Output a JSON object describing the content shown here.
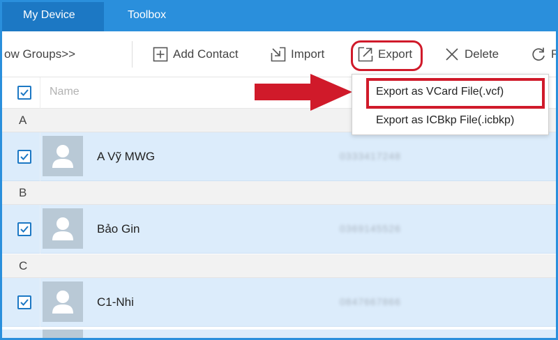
{
  "tabs": [
    {
      "label": "My Device",
      "active": true
    },
    {
      "label": "Toolbox",
      "active": false
    }
  ],
  "toolbar": {
    "groups_label": "ow Groups>>",
    "add_contact_label": "Add Contact",
    "import_label": "Import",
    "export_label": "Export",
    "delete_label": "Delete",
    "refresh_label": "R"
  },
  "list_header": {
    "name_column": "Name",
    "select_all_checked": true
  },
  "export_menu": {
    "items": [
      {
        "label": "Export as VCard File(.vcf)",
        "highlighted": true
      },
      {
        "label": "Export as ICBkp File(.icbkp)",
        "highlighted": false
      }
    ]
  },
  "sections": [
    {
      "letter": "A",
      "contacts": [
        {
          "name": "A Vỹ MWG",
          "phone": "0333417248",
          "checked": true
        }
      ]
    },
    {
      "letter": "B",
      "contacts": [
        {
          "name": "Bảo Gin",
          "phone": "0369145526",
          "checked": true
        }
      ]
    },
    {
      "letter": "C",
      "contacts": [
        {
          "name": "C1-Nhi",
          "phone": "0847667866",
          "checked": true
        }
      ]
    }
  ],
  "colors": {
    "brand_blue": "#2a8fdc",
    "active_tab": "#1c78c4",
    "annotation_red": "#d01a2a",
    "selected_row": "#dcecfb"
  }
}
